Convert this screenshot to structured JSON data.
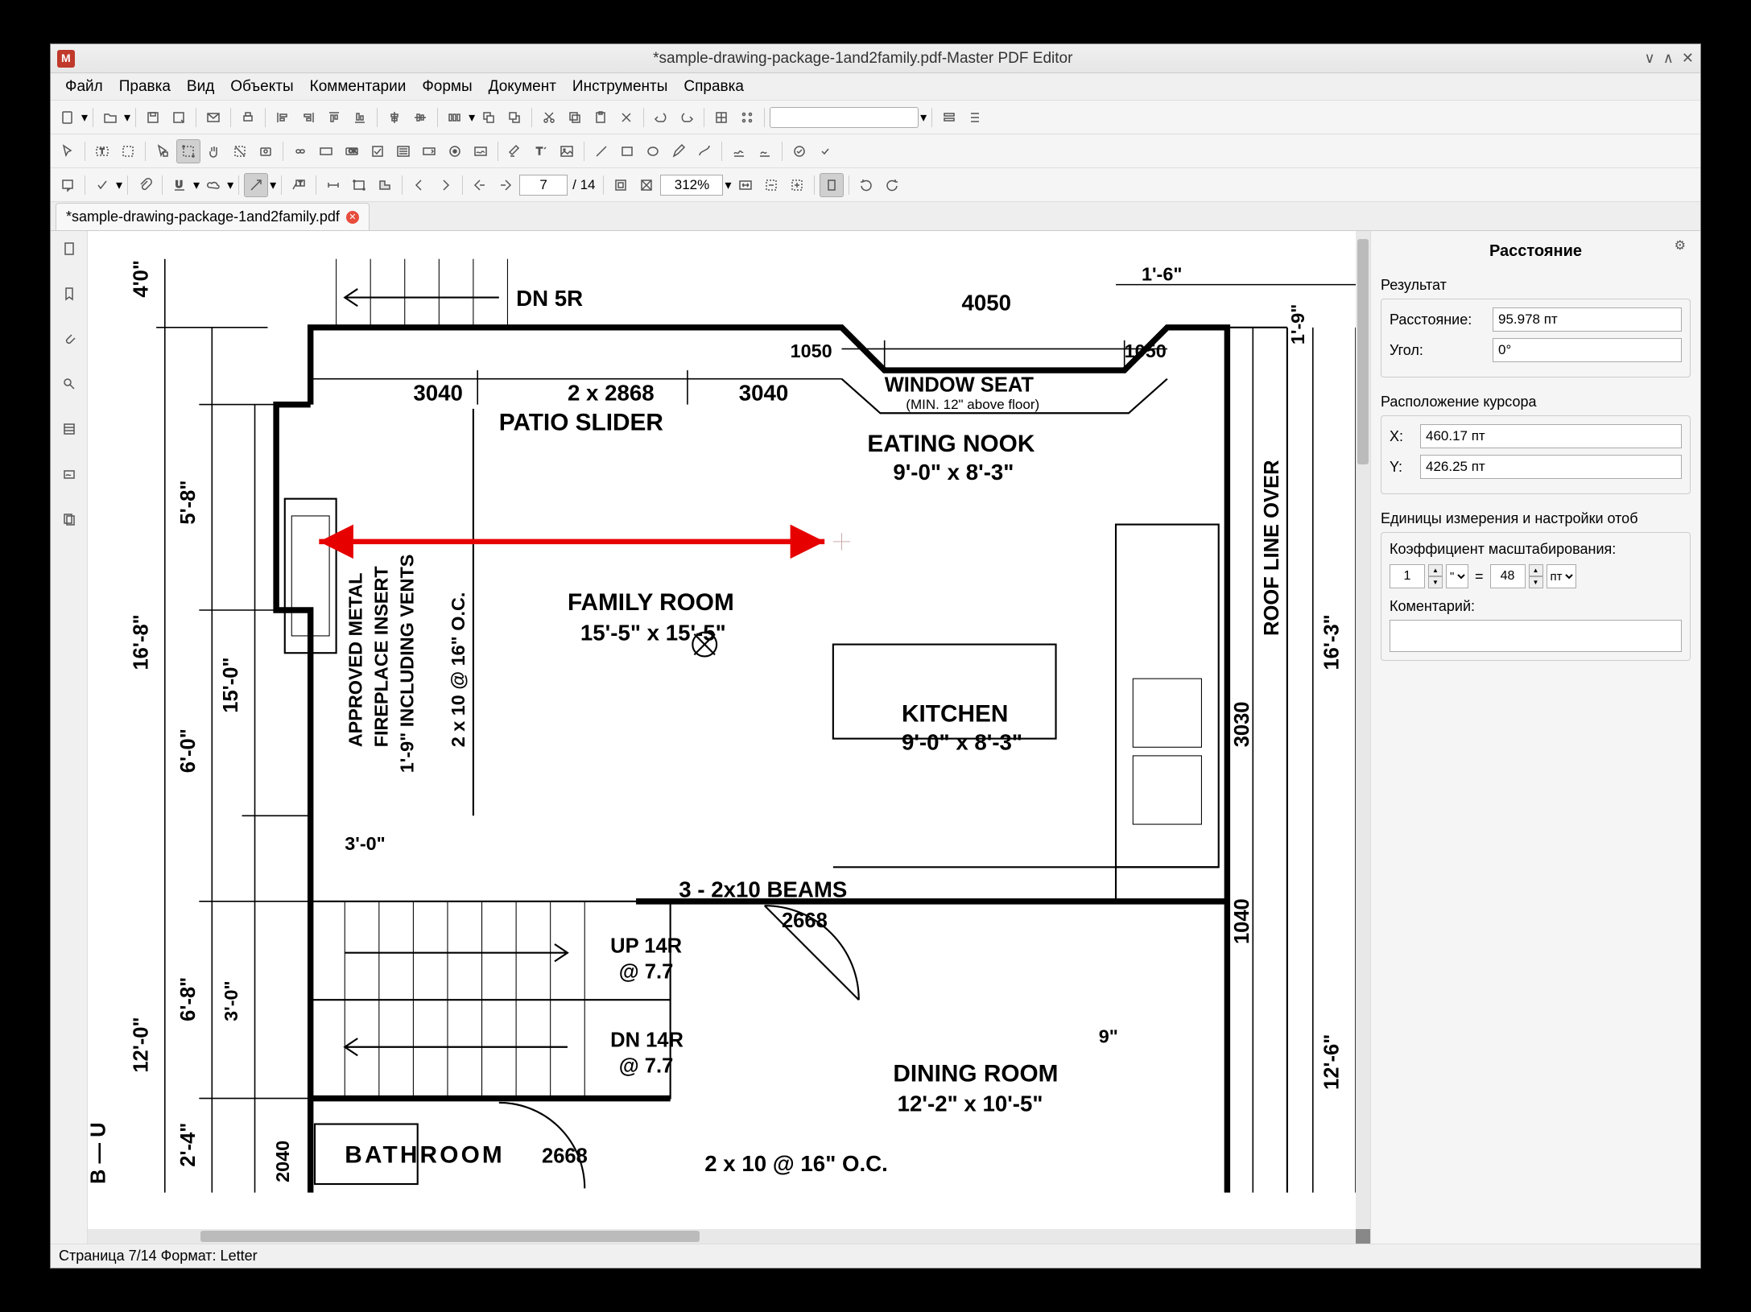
{
  "window": {
    "title": "*sample-drawing-package-1and2family.pdf-Master PDF Editor"
  },
  "menu": {
    "items": [
      "Файл",
      "Правка",
      "Вид",
      "Объекты",
      "Комментарии",
      "Формы",
      "Документ",
      "Инструменты",
      "Справка"
    ]
  },
  "tab": {
    "name": "*sample-drawing-package-1and2family.pdf"
  },
  "nav": {
    "page_current": "7",
    "page_total": "/ 14",
    "zoom": "312%"
  },
  "panel": {
    "title": "Расстояние",
    "result_label": "Результат",
    "distance_label": "Расстояние:",
    "distance_value": "95.978 пт",
    "angle_label": "Угол:",
    "angle_value": "0°",
    "cursor_label": "Расположение курсора",
    "x_label": "X:",
    "x_value": "460.17 пт",
    "y_label": "Y:",
    "y_value": "426.25 пт",
    "units_label": "Единицы измерения и настройки отоб",
    "scale_label": "Коэффициент масштабирования:",
    "scale_from": "1",
    "scale_from_unit": "\"",
    "scale_eq": "=",
    "scale_to": "48",
    "scale_to_unit": "пт",
    "comment_label": "Коментарий:"
  },
  "status": {
    "text": "Страница 7/14 Формат: Letter"
  },
  "drawing_labels": {
    "dn5r": "DN 5R",
    "l40": "4'0\"",
    "l58": "5'-8\"",
    "l168": "16'-8\"",
    "l150": "15'-0\"",
    "l60": "6'-0\"",
    "l68": "6'-8\"",
    "l120": "12'-0\"",
    "l24": "2'-4\"",
    "d3040a": "3040",
    "d2868": "2 x 2868",
    "d3040b": "3040",
    "d1050a": "1050",
    "d1050b": "1050",
    "d4050": "4050",
    "d16": "1'-6\"",
    "d19": "1'-9\"",
    "patio": "PATIO SLIDER",
    "windowseat": "WINDOW SEAT",
    "windowseat_sub": "(MIN. 12\" above floor)",
    "eating": "EATING NOOK",
    "eating_dim": "9'-0\" x 8'-3\"",
    "family": "FAMILY ROOM",
    "family_dim": "15'-5\" x 15'-5\"",
    "kitchen": "KITCHEN",
    "kitchen_dim": "9'-0\" x 8'-3\"",
    "dining": "DINING ROOM",
    "dining_dim": "12'-2\" x 10'-5\"",
    "bathroom": "BATHROOM",
    "approved": "APPROVED METAL",
    "fireplace": "FIREPLACE INSERT",
    "vents": "1'-9\" INCLUDING VENTS",
    "joists": "2 x 10 @ 16\" O.C.",
    "roof": "ROOF LINE OVER",
    "d163": "16'-3\"",
    "d3030": "3030",
    "d1040": "1040",
    "d126": "12'-6\"",
    "d9": "9\"",
    "beams": "3 - 2x10 BEAMS",
    "d2668a": "2668",
    "d2668b": "2668",
    "up14r": "UP 14R",
    "up_at": "@ 7.7",
    "dn14r": "DN 14R",
    "dn_at": "@ 7.7",
    "d30a": "3'-0\"",
    "d30b": "3'-0\"",
    "d2040": "2040",
    "joists2": "2 x 10 @ 16\" O.C.",
    "bu": "B — U"
  }
}
